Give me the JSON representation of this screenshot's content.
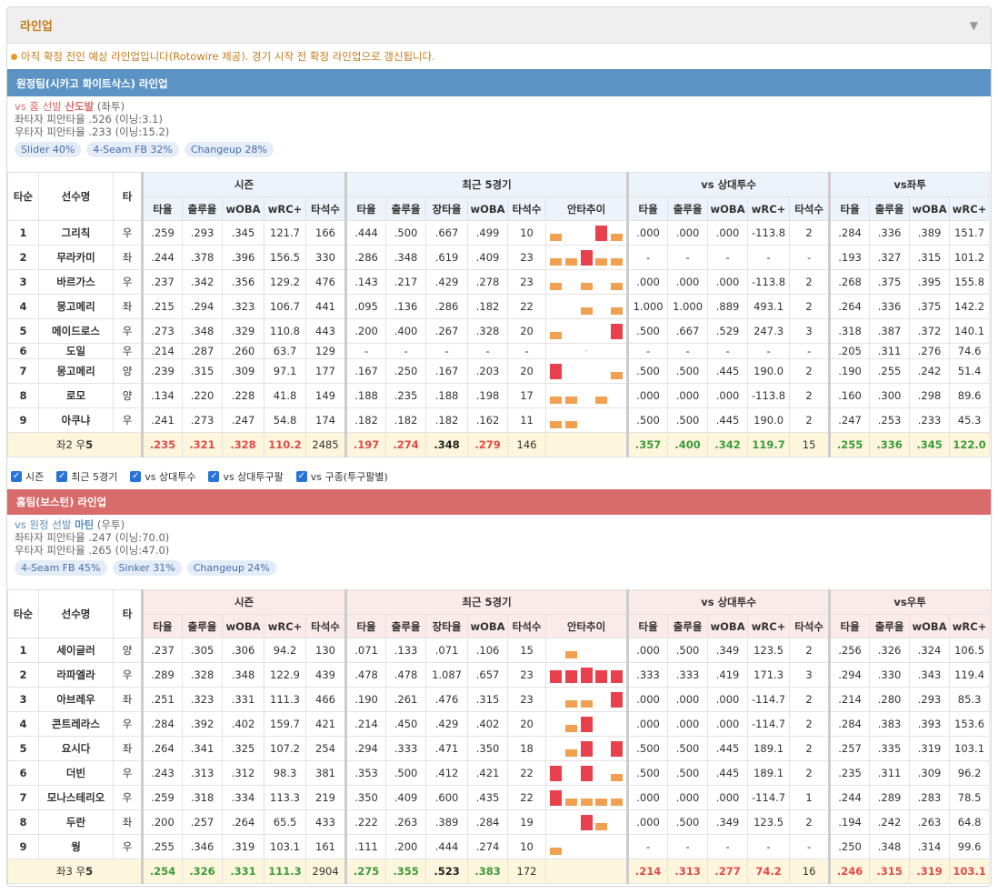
{
  "panel": {
    "title": "라인업",
    "notice": "아직 확정 전인 예상 라인업입니다(Rotowire 제공). 경기 시작 전 확정 라인업으로 갱신됩니다."
  },
  "headers": {
    "order": "타순",
    "name": "선수명",
    "hand": "타",
    "season": "시즌",
    "recent": "최근 5경기",
    "vsp": "vs 상대투수",
    "cols_season": [
      "타율",
      "출루율",
      "wOBA",
      "wRC+",
      "타석수"
    ],
    "cols_recent": [
      "타율",
      "출루율",
      "장타율",
      "wOBA",
      "타석수",
      "안타추이"
    ],
    "cols_vsp": [
      "타율",
      "출루율",
      "wOBA",
      "wRC+",
      "타석수"
    ],
    "cols_split": [
      "타율",
      "출루율",
      "wOBA",
      "wRC+"
    ]
  },
  "away": {
    "title": "원정팀(시카고 화이트삭스) 라인업",
    "sp_prefix": "vs 홈 선발 ",
    "sp_name": "산도발",
    "sp_hand": " (좌투)",
    "vs_left": "좌타자 피안타율 .526 (이닝:3.1)",
    "vs_right": "우타자 피안타율 .233 (이닝:15.2)",
    "pitches": [
      "Slider 40%",
      "4-Seam FB 32%",
      "Changeup 28%"
    ],
    "split_label": "vs좌투",
    "rows": [
      {
        "o": "1",
        "n": "그리칙",
        "h": "우",
        "s": [
          ".259",
          ".293",
          ".345",
          "121.7",
          "166"
        ],
        "r": [
          ".444",
          ".500",
          ".667",
          ".499",
          "10"
        ],
        "spark": [
          [
            "o",
            0.45
          ],
          [
            "",
            0
          ],
          [
            "",
            0
          ],
          [
            "r",
            1
          ],
          [
            "o",
            0.45
          ]
        ],
        "v": [
          ".000",
          ".000",
          ".000",
          "-113.8",
          "2"
        ],
        "sp": [
          ".284",
          ".336",
          ".389",
          "151.7"
        ]
      },
      {
        "o": "2",
        "n": "무라카미",
        "h": "좌",
        "s": [
          ".244",
          ".378",
          ".396",
          "156.5",
          "330"
        ],
        "r": [
          ".286",
          ".348",
          ".619",
          ".409",
          "23"
        ],
        "spark": [
          [
            "o",
            0.45
          ],
          [
            "o",
            0.45
          ],
          [
            "r",
            1
          ],
          [
            "o",
            0.45
          ],
          [
            "o",
            0.45
          ]
        ],
        "v": [
          "-",
          "-",
          "-",
          "-",
          "-"
        ],
        "sp": [
          ".193",
          ".327",
          ".315",
          "101.2"
        ]
      },
      {
        "o": "3",
        "n": "바르가스",
        "h": "우",
        "s": [
          ".237",
          ".342",
          ".356",
          "129.2",
          "476"
        ],
        "r": [
          ".143",
          ".217",
          ".429",
          ".278",
          "23"
        ],
        "spark": [
          [
            "o",
            0.45
          ],
          [
            "",
            0
          ],
          [
            "o",
            0.45
          ],
          [
            "",
            0
          ],
          [
            "o",
            0.45
          ]
        ],
        "v": [
          ".000",
          ".000",
          ".000",
          "-113.8",
          "2"
        ],
        "sp": [
          ".268",
          ".375",
          ".395",
          "155.8"
        ]
      },
      {
        "o": "4",
        "n": "몽고메리",
        "h": "좌",
        "s": [
          ".215",
          ".294",
          ".323",
          "106.7",
          "441"
        ],
        "r": [
          ".095",
          ".136",
          ".286",
          ".182",
          "22"
        ],
        "spark": [
          [
            "",
            0
          ],
          [
            "",
            0
          ],
          [
            "o",
            0.45
          ],
          [
            "",
            0
          ],
          [
            "o",
            0.45
          ]
        ],
        "v": [
          "1.000",
          "1.000",
          ".889",
          "493.1",
          "2"
        ],
        "sp": [
          ".264",
          ".336",
          ".375",
          "142.2"
        ]
      },
      {
        "o": "5",
        "n": "메이드로스",
        "h": "우",
        "s": [
          ".273",
          ".348",
          ".329",
          "110.8",
          "443"
        ],
        "r": [
          ".200",
          ".400",
          ".267",
          ".328",
          "20"
        ],
        "spark": [
          [
            "o",
            0.45
          ],
          [
            "",
            0
          ],
          [
            "",
            0
          ],
          [
            "",
            0
          ],
          [
            "r",
            1
          ]
        ],
        "v": [
          ".500",
          ".667",
          ".529",
          "247.3",
          "3"
        ],
        "sp": [
          ".318",
          ".387",
          ".372",
          "140.1"
        ]
      },
      {
        "o": "6",
        "n": "도일",
        "h": "우",
        "s": [
          ".214",
          ".287",
          ".260",
          "63.7",
          "129"
        ],
        "r": [
          "-",
          "-",
          "-",
          "-",
          "-"
        ],
        "spark": "-",
        "v": [
          "-",
          "-",
          "-",
          "-",
          "-"
        ],
        "sp": [
          ".205",
          ".311",
          ".276",
          "74.6"
        ]
      },
      {
        "o": "7",
        "n": "몽고메리",
        "h": "양",
        "s": [
          ".239",
          ".315",
          ".309",
          "97.1",
          "177"
        ],
        "r": [
          ".167",
          ".250",
          ".167",
          ".203",
          "20"
        ],
        "spark": [
          [
            "r",
            1
          ],
          [
            "",
            0
          ],
          [
            "",
            0
          ],
          [
            "",
            0
          ],
          [
            "o",
            0.45
          ]
        ],
        "v": [
          ".500",
          ".500",
          ".445",
          "190.0",
          "2"
        ],
        "sp": [
          ".190",
          ".255",
          ".242",
          "51.4"
        ]
      },
      {
        "o": "8",
        "n": "로모",
        "h": "양",
        "s": [
          ".134",
          ".220",
          ".228",
          "41.8",
          "149"
        ],
        "r": [
          ".188",
          ".235",
          ".188",
          ".198",
          "17"
        ],
        "spark": [
          [
            "o",
            0.45
          ],
          [
            "o",
            0.45
          ],
          [
            "",
            0
          ],
          [
            "o",
            0.45
          ],
          [
            "",
            0
          ]
        ],
        "v": [
          ".000",
          ".000",
          ".000",
          "-113.8",
          "2"
        ],
        "sp": [
          ".160",
          ".300",
          ".298",
          "89.6"
        ]
      },
      {
        "o": "9",
        "n": "아쿠냐",
        "h": "우",
        "s": [
          ".241",
          ".273",
          ".247",
          "54.8",
          "174"
        ],
        "r": [
          ".182",
          ".182",
          ".182",
          ".162",
          "11"
        ],
        "spark": [
          [
            "o",
            0.45
          ],
          [
            "o",
            0.45
          ],
          [
            "",
            0
          ],
          [
            "",
            0
          ],
          [
            "",
            0
          ]
        ],
        "v": [
          ".500",
          ".500",
          ".445",
          "190.0",
          "2"
        ],
        "sp": [
          ".247",
          ".253",
          ".233",
          "45.3"
        ]
      }
    ],
    "total": {
      "label_a": "좌2 우",
      "label_b": "5",
      "s": [
        ".235",
        ".321",
        ".328",
        "110.2",
        "2485"
      ],
      "r": [
        ".197",
        ".274",
        ".348",
        ".279",
        "146"
      ],
      "v": [
        ".357",
        ".400",
        ".342",
        "119.7",
        "15"
      ],
      "sp": [
        ".255",
        ".336",
        ".345",
        "122.0"
      ]
    }
  },
  "checks": [
    "시즌",
    "최근 5경기",
    "vs 상대투수",
    "vs 상대투구팔",
    "vs 구종(투구팔별)"
  ],
  "home": {
    "title": "홈팀(보스턴) 라인업",
    "sp_prefix": "vs 원정 선발 ",
    "sp_name": "마틴",
    "sp_hand": " (우투)",
    "vs_left": "좌타자 피안타율 .247 (이닝:70.0)",
    "vs_right": "우타자 피안타율 .265 (이닝:47.0)",
    "pitches": [
      "4-Seam FB 45%",
      "Sinker 31%",
      "Changeup 24%"
    ],
    "split_label": "vs우투",
    "rows": [
      {
        "o": "1",
        "n": "세이글러",
        "h": "양",
        "s": [
          ".237",
          ".305",
          ".306",
          "94.2",
          "130"
        ],
        "r": [
          ".071",
          ".133",
          ".071",
          ".106",
          "15"
        ],
        "spark": [
          [
            "",
            0
          ],
          [
            "o",
            0.45
          ],
          [
            "",
            0
          ],
          [
            "",
            0
          ],
          [
            "",
            0
          ]
        ],
        "v": [
          ".000",
          ".500",
          ".349",
          "123.5",
          "2"
        ],
        "sp": [
          ".256",
          ".326",
          ".324",
          "106.5"
        ]
      },
      {
        "o": "2",
        "n": "라파엘라",
        "h": "우",
        "s": [
          ".289",
          ".328",
          ".348",
          "122.9",
          "439"
        ],
        "r": [
          ".478",
          ".478",
          "1.087",
          ".657",
          "23"
        ],
        "spark": [
          [
            "r",
            0.8
          ],
          [
            "r",
            0.8
          ],
          [
            "r",
            1
          ],
          [
            "r",
            0.8
          ],
          [
            "r",
            0.8
          ]
        ],
        "v": [
          ".333",
          ".333",
          ".419",
          "171.3",
          "3"
        ],
        "sp": [
          ".294",
          ".330",
          ".343",
          "119.4"
        ]
      },
      {
        "o": "3",
        "n": "아브레우",
        "h": "좌",
        "s": [
          ".251",
          ".323",
          ".331",
          "111.3",
          "466"
        ],
        "r": [
          ".190",
          ".261",
          ".476",
          ".315",
          "23"
        ],
        "spark": [
          [
            "",
            0
          ],
          [
            "o",
            0.45
          ],
          [
            "o",
            0.45
          ],
          [
            "",
            0
          ],
          [
            "r",
            1
          ]
        ],
        "v": [
          ".000",
          ".000",
          ".000",
          "-114.7",
          "2"
        ],
        "sp": [
          ".214",
          ".280",
          ".293",
          "85.3"
        ]
      },
      {
        "o": "4",
        "n": "콘트레라스",
        "h": "우",
        "s": [
          ".284",
          ".392",
          ".402",
          "159.7",
          "421"
        ],
        "r": [
          ".214",
          ".450",
          ".429",
          ".402",
          "20"
        ],
        "spark": [
          [
            "",
            0
          ],
          [
            "o",
            0.45
          ],
          [
            "r",
            1
          ],
          [
            "",
            0
          ],
          [
            "",
            0
          ]
        ],
        "v": [
          ".000",
          ".000",
          ".000",
          "-114.7",
          "2"
        ],
        "sp": [
          ".284",
          ".383",
          ".393",
          "153.6"
        ]
      },
      {
        "o": "5",
        "n": "요시다",
        "h": "좌",
        "s": [
          ".264",
          ".341",
          ".325",
          "107.2",
          "254"
        ],
        "r": [
          ".294",
          ".333",
          ".471",
          ".350",
          "18"
        ],
        "spark": [
          [
            "",
            0
          ],
          [
            "o",
            0.45
          ],
          [
            "r",
            1
          ],
          [
            "",
            0
          ],
          [
            "r",
            1
          ]
        ],
        "v": [
          ".500",
          ".500",
          ".445",
          "189.1",
          "2"
        ],
        "sp": [
          ".257",
          ".335",
          ".319",
          "103.1"
        ]
      },
      {
        "o": "6",
        "n": "더빈",
        "h": "우",
        "s": [
          ".243",
          ".313",
          ".312",
          "98.3",
          "381"
        ],
        "r": [
          ".353",
          ".500",
          ".412",
          ".421",
          "22"
        ],
        "spark": [
          [
            "r",
            1
          ],
          [
            "",
            0
          ],
          [
            "r",
            1
          ],
          [
            "",
            0
          ],
          [
            "o",
            0.45
          ]
        ],
        "v": [
          ".500",
          ".500",
          ".445",
          "189.1",
          "2"
        ],
        "sp": [
          ".235",
          ".311",
          ".309",
          "96.2"
        ]
      },
      {
        "o": "7",
        "n": "모나스테리오",
        "h": "우",
        "s": [
          ".259",
          ".318",
          ".334",
          "113.3",
          "219"
        ],
        "r": [
          ".350",
          ".409",
          ".600",
          ".435",
          "22"
        ],
        "spark": [
          [
            "r",
            1
          ],
          [
            "o",
            0.45
          ],
          [
            "o",
            0.45
          ],
          [
            "o",
            0.45
          ],
          [
            "o",
            0.45
          ]
        ],
        "v": [
          ".000",
          ".000",
          ".000",
          "-114.7",
          "1"
        ],
        "sp": [
          ".244",
          ".289",
          ".283",
          "78.5"
        ]
      },
      {
        "o": "8",
        "n": "두란",
        "h": "좌",
        "s": [
          ".200",
          ".257",
          ".264",
          "65.5",
          "433"
        ],
        "r": [
          ".222",
          ".263",
          ".389",
          ".284",
          "19"
        ],
        "spark": [
          [
            "",
            0
          ],
          [
            "",
            0
          ],
          [
            "r",
            1
          ],
          [
            "o",
            0.45
          ],
          [
            "",
            0
          ]
        ],
        "v": [
          ".000",
          ".500",
          ".349",
          "123.5",
          "2"
        ],
        "sp": [
          ".194",
          ".242",
          ".263",
          "64.8"
        ]
      },
      {
        "o": "9",
        "n": "웡",
        "h": "우",
        "s": [
          ".255",
          ".346",
          ".319",
          "103.1",
          "161"
        ],
        "r": [
          ".111",
          ".200",
          ".444",
          ".274",
          "10"
        ],
        "spark": [
          [
            "o",
            0.45
          ],
          [
            "",
            0
          ],
          [
            "",
            0
          ],
          [
            "",
            0
          ],
          [
            "",
            0
          ]
        ],
        "v": [
          "-",
          "-",
          "-",
          "-",
          "-"
        ],
        "sp": [
          ".250",
          ".348",
          ".314",
          "99.6"
        ]
      }
    ],
    "total": {
      "label_a": "좌3 우",
      "label_b": "5",
      "s": [
        ".254",
        ".326",
        ".331",
        "111.3",
        "2904"
      ],
      "r": [
        ".275",
        ".355",
        ".523",
        ".383",
        "172"
      ],
      "v": [
        ".214",
        ".313",
        ".277",
        "74.2",
        "16"
      ],
      "sp": [
        ".246",
        ".315",
        ".319",
        "103.1"
      ]
    }
  },
  "colors": {
    "away": "#5b93c4",
    "home": "#d96b6b",
    "orange": "#f0a050",
    "red": "#e8404c",
    "green": "#3c9a3c"
  }
}
